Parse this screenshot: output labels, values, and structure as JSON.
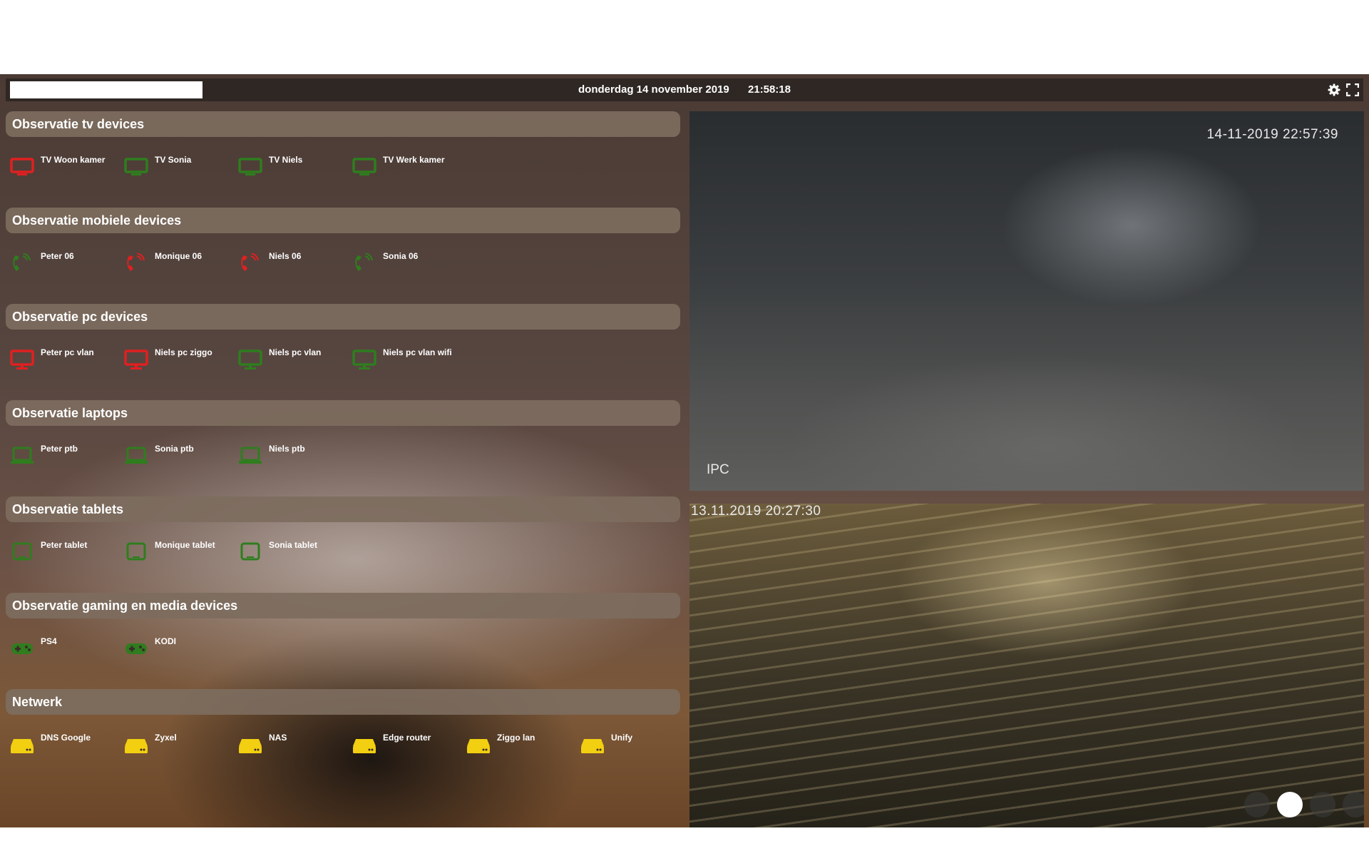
{
  "topbar": {
    "search": {
      "value": "",
      "placeholder": ""
    },
    "date": "donderdag 14 november 2019",
    "time": "21:58:18",
    "settings_icon": "gear-icon",
    "fullscreen_icon": "fullscreen-icon"
  },
  "colors": {
    "offline_red": "#e02020",
    "online_green": "#2f7d1e",
    "network_yellow": "#f2cf10",
    "header_bg": "#7d6c5e",
    "topbar_bg": "#2e2724"
  },
  "sections": [
    {
      "title": "Observatie tv devices",
      "devices": [
        {
          "label": "TV Woon kamer",
          "icon": "tv-icon",
          "status": "red"
        },
        {
          "label": "TV Sonia",
          "icon": "tv-icon",
          "status": "green"
        },
        {
          "label": "TV Niels",
          "icon": "tv-icon",
          "status": "green"
        },
        {
          "label": "TV Werk kamer",
          "icon": "tv-icon",
          "status": "green"
        }
      ]
    },
    {
      "title": "Observatie mobiele devices",
      "devices": [
        {
          "label": "Peter 06",
          "icon": "phone-icon",
          "status": "green"
        },
        {
          "label": "Monique 06",
          "icon": "phone-icon",
          "status": "red"
        },
        {
          "label": "Niels 06",
          "icon": "phone-icon",
          "status": "red"
        },
        {
          "label": "Sonia 06",
          "icon": "phone-icon",
          "status": "green"
        }
      ]
    },
    {
      "title": "Observatie pc devices",
      "devices": [
        {
          "label": "Peter pc vlan",
          "icon": "monitor-icon",
          "status": "red"
        },
        {
          "label": "Niels pc ziggo",
          "icon": "monitor-icon",
          "status": "red"
        },
        {
          "label": "Niels pc vlan",
          "icon": "monitor-icon",
          "status": "green"
        },
        {
          "label": "Niels pc vlan wifi",
          "icon": "monitor-icon",
          "status": "green"
        }
      ]
    },
    {
      "title": "Observatie laptops",
      "devices": [
        {
          "label": "Peter ptb",
          "icon": "laptop-icon",
          "status": "green"
        },
        {
          "label": "Sonia ptb",
          "icon": "laptop-icon",
          "status": "green"
        },
        {
          "label": "Niels ptb",
          "icon": "laptop-icon",
          "status": "green"
        }
      ]
    },
    {
      "title": "Observatie tablets",
      "devices": [
        {
          "label": "Peter tablet",
          "icon": "tablet-icon",
          "status": "green"
        },
        {
          "label": "Monique tablet",
          "icon": "tablet-icon",
          "status": "green"
        },
        {
          "label": "Sonia tablet",
          "icon": "tablet-icon",
          "status": "green"
        }
      ]
    },
    {
      "title": "Observatie gaming en media devices",
      "devices": [
        {
          "label": "PS4",
          "icon": "gamepad-icon",
          "status": "green"
        },
        {
          "label": "KODI",
          "icon": "gamepad-icon",
          "status": "green"
        }
      ]
    },
    {
      "title": "Netwerk",
      "devices": [
        {
          "label": "DNS Google",
          "icon": "server-icon",
          "status": "yellow"
        },
        {
          "label": "Zyxel",
          "icon": "server-icon",
          "status": "yellow"
        },
        {
          "label": "NAS",
          "icon": "server-icon",
          "status": "yellow"
        },
        {
          "label": "Edge router",
          "icon": "server-icon",
          "status": "yellow"
        },
        {
          "label": "Ziggo lan",
          "icon": "server-icon",
          "status": "yellow"
        },
        {
          "label": "Unify",
          "icon": "server-icon",
          "status": "yellow"
        }
      ]
    }
  ],
  "cameras": [
    {
      "timestamp": "14-11-2019 22:57:39",
      "label": "IPC"
    },
    {
      "timestamp": "13.11.2019 20:27:30",
      "label": ""
    }
  ],
  "slider": {
    "count": 4,
    "active_index": 1
  }
}
